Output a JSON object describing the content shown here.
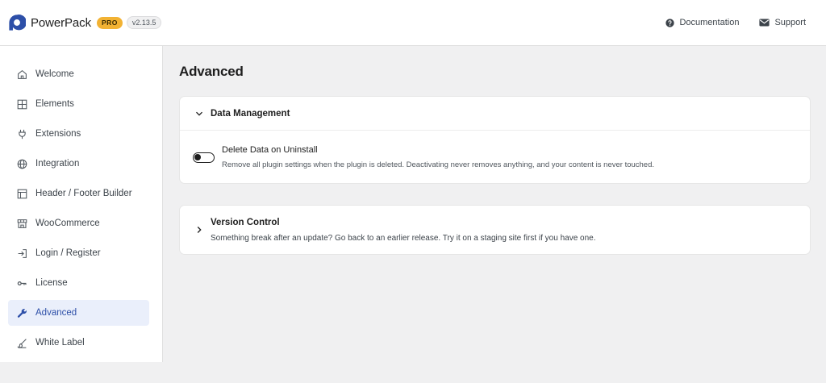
{
  "header": {
    "brand_name": "PowerPack",
    "pro_label": "PRO",
    "version": "v2.13.5",
    "links": [
      {
        "label": "Documentation",
        "icon": "help-circle-icon"
      },
      {
        "label": "Support",
        "icon": "mail-icon"
      }
    ]
  },
  "sidebar": {
    "items": [
      {
        "label": "Welcome",
        "icon": "home-icon"
      },
      {
        "label": "Elements",
        "icon": "grid-icon"
      },
      {
        "label": "Extensions",
        "icon": "plug-icon"
      },
      {
        "label": "Integration",
        "icon": "globe-icon"
      },
      {
        "label": "Header / Footer Builder",
        "icon": "layout-icon"
      },
      {
        "label": "WooCommerce",
        "icon": "store-icon"
      },
      {
        "label": "Login / Register",
        "icon": "login-icon"
      },
      {
        "label": "License",
        "icon": "key-icon"
      },
      {
        "label": "Advanced",
        "icon": "wrench-icon",
        "active": true
      },
      {
        "label": "White Label",
        "icon": "brush-icon"
      }
    ]
  },
  "main": {
    "title": "Advanced",
    "data_management": {
      "title": "Data Management",
      "setting": {
        "title": "Delete Data on Uninstall",
        "description": "Remove all plugin settings when the plugin is deleted. Deactivating never removes anything, and your content is never touched.",
        "enabled": false
      }
    },
    "version_control": {
      "title": "Version Control",
      "description": "Something break after an update? Go back to an earlier release. Try it on a staging site first if you have one."
    }
  },
  "colors": {
    "accent": "#2d4fa8",
    "active_bg": "#eaeffb",
    "pro_badge": "#f2b233",
    "background": "#f0f0f1"
  }
}
